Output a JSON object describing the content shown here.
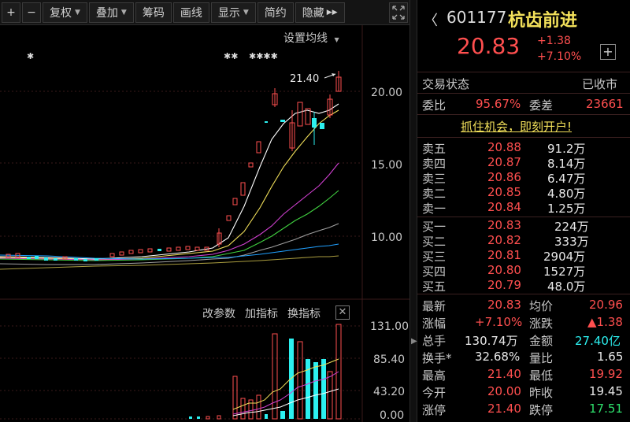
{
  "toolbar": {
    "zoom_in": "+",
    "zoom_out": "−",
    "fuquan": "复权",
    "diejia": "叠加",
    "chouma": "筹码",
    "huaxian": "画线",
    "xianshi": "显示",
    "jianyue": "简约",
    "yincang": "隐藏",
    "hide_arrows": "▶▶"
  },
  "chart": {
    "ma_setting": "设置均线",
    "high_label": "21.40",
    "price_axis": [
      "20.00",
      "15.00",
      "10.00"
    ],
    "markers_left": "✱",
    "markers_mid": "✱✱",
    "markers_right": "✱✱✱✱",
    "indicator_bar": [
      "改参数",
      "加指标",
      "换指标"
    ],
    "indicator_close": "✕",
    "volume_axis": [
      "131.00",
      "85.40",
      "43.20",
      "0.00"
    ]
  },
  "quote": {
    "back": "〈",
    "code": "601177",
    "name": "杭齿前进",
    "price": "20.83",
    "change": "+1.38",
    "change_pct": "+7.10%",
    "add": "+",
    "status_label": "交易状态",
    "status_value": "已收市",
    "weibi_label": "委比",
    "weibi_value": "95.67%",
    "weicha_label": "委差",
    "weicha_value": "23661",
    "promo": "抓住机会，即刻开户!",
    "sell": [
      {
        "label": "卖五",
        "price": "20.88",
        "vol": "91.2万"
      },
      {
        "label": "卖四",
        "price": "20.87",
        "vol": "8.14万"
      },
      {
        "label": "卖三",
        "price": "20.86",
        "vol": "6.47万"
      },
      {
        "label": "卖二",
        "price": "20.85",
        "vol": "4.80万"
      },
      {
        "label": "卖一",
        "price": "20.84",
        "vol": "1.25万"
      }
    ],
    "buy": [
      {
        "label": "买一",
        "price": "20.83",
        "vol": "224万"
      },
      {
        "label": "买二",
        "price": "20.82",
        "vol": "333万"
      },
      {
        "label": "买三",
        "price": "20.81",
        "vol": "2904万"
      },
      {
        "label": "买四",
        "price": "20.80",
        "vol": "1527万"
      },
      {
        "label": "买五",
        "price": "20.79",
        "vol": "48.0万"
      }
    ],
    "stats": [
      {
        "l1": "最新",
        "v1": "20.83",
        "c1": "red",
        "l2": "均价",
        "v2": "20.96",
        "c2": "red"
      },
      {
        "l1": "涨幅",
        "v1": "+7.10%",
        "c1": "red",
        "l2": "涨跌",
        "v2": "▲1.38",
        "c2": "red"
      },
      {
        "l1": "总手",
        "v1": "130.74万",
        "c1": "wht",
        "l2": "金额",
        "v2": "27.40亿",
        "c2": "cyan"
      },
      {
        "l1": "换手*",
        "v1": "32.68%",
        "c1": "wht",
        "l2": "量比",
        "v2": "1.65",
        "c2": "wht"
      },
      {
        "l1": "最高",
        "v1": "21.40",
        "c1": "red",
        "l2": "最低",
        "v2": "19.92",
        "c2": "red"
      },
      {
        "l1": "今开",
        "v1": "20.00",
        "c1": "red",
        "l2": "昨收",
        "v2": "19.45",
        "c2": "wht"
      },
      {
        "l1": "涨停",
        "v1": "21.40",
        "c1": "red",
        "l2": "跌停",
        "v2": "17.51",
        "c2": "grn"
      }
    ]
  },
  "colors": {
    "up": "#ff4f4f",
    "down": "#2cf0f0",
    "name": "#f2e05a",
    "ma5": "#ffffff",
    "ma10": "#f2e05a",
    "ma20": "#d040d0",
    "ma30": "#40d040",
    "ma60": "#a0a0a0",
    "ma120": "#20a0ff"
  }
}
